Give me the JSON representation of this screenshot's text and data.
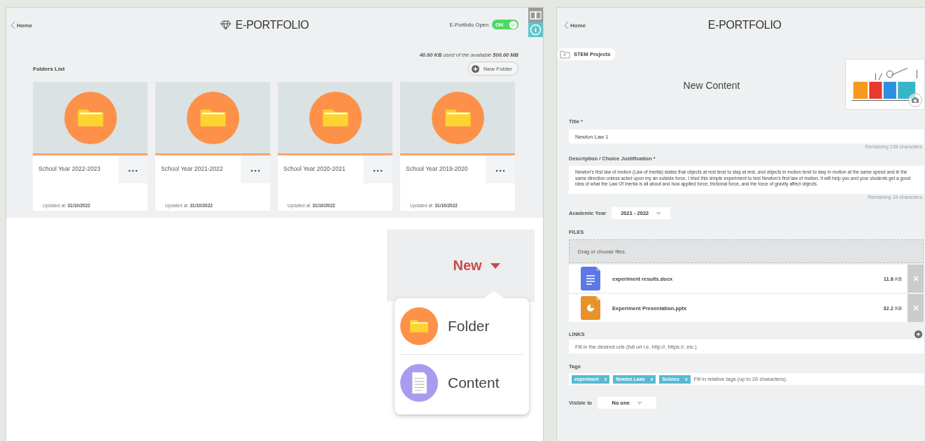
{
  "left": {
    "home_link": "Home",
    "title": "E-PORTFOLIO",
    "toggle": {
      "label": "E-Portfolio Open:",
      "text": "ON",
      "on": true
    },
    "storage": "**40.60 KB** used of the available **500.00 MB**",
    "folders_heading": "Folders List",
    "new_folder_button": "New Folder",
    "folders": [
      {
        "name": "School Year 2022-2023",
        "updated_label": "Updated at:",
        "updated": "31/10/2022"
      },
      {
        "name": "School Year 2021-2022",
        "updated_label": "Updated at:",
        "updated": "31/10/2022"
      },
      {
        "name": "School Year 2020-2021",
        "updated_label": "Updated at:",
        "updated": "31/10/2022"
      },
      {
        "name": "School Year 2019-2020",
        "updated_label": "Updated at:",
        "updated": "31/10/2022"
      }
    ],
    "new_menu": {
      "button": "New",
      "items": [
        {
          "kind": "folder",
          "label": "Folder"
        },
        {
          "kind": "content",
          "label": "Content"
        }
      ]
    }
  },
  "right": {
    "home_link": "Home",
    "title": "E-PORTFOLIO",
    "folder_chip": "STEM Projects",
    "heading": "New Content",
    "title_field": {
      "label": "Title *",
      "value": "Newton Law 1",
      "remaining": "Remaining 138 characters."
    },
    "description_field": {
      "label": "Description / Choice Justification *",
      "value": "Newton’s first law of motion  (Law of Inertia) states that objects at rest tend to stay at rest, and objects in motion tend to stay in motion at the same speed and in the same direction unless acted upon my an outside force. I tried this simple experiment to test Newton’s first law of motion. It will help you and your students get a good idea of what the Law Of Inertia is all about and how applied force, frictional force, and the force of gravity affect objects.",
      "remaining": "Remaining 34 characters."
    },
    "academic_year": {
      "label": "Academic Year",
      "value": "2021 - 2022"
    },
    "files": {
      "heading": "FILES",
      "dropzone": "Drag or choose files.",
      "items": [
        {
          "kind": "document",
          "name": "experiment results.docx",
          "size": "**11.8** KB"
        },
        {
          "kind": "presentation",
          "name": "Experiment Presentation.pptx",
          "size": "**32.2** KB"
        }
      ]
    },
    "links": {
      "heading": "LINKS",
      "placeholder": "Fill in the desired urls (full url i.e. http://, https://, etc.)"
    },
    "tags": {
      "label": "Tags",
      "items": [
        {
          "label": "experiment",
          "remove": "x"
        },
        {
          "label": "Newton Laws",
          "remove": "x"
        },
        {
          "label": "Science",
          "remove": "x"
        }
      ],
      "placeholder": "Fill in relative tags (up to 20 characters)."
    },
    "visible_to": {
      "label": "Visible to",
      "value": "No one"
    }
  }
}
